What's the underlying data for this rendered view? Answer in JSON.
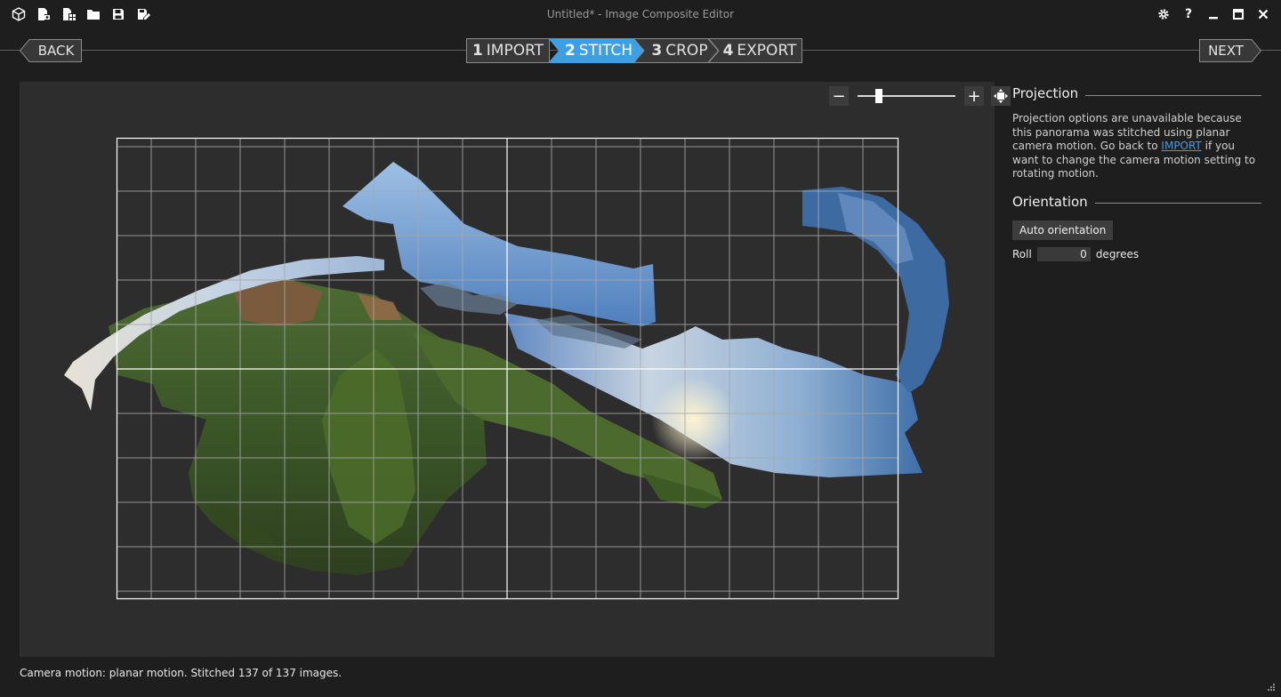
{
  "window": {
    "title": "Untitled* - Image Composite Editor",
    "toolbar_icons": [
      "new-panorama-icon",
      "new-from-video-icon",
      "new-structured-icon",
      "open-icon",
      "save-icon",
      "save-as-icon"
    ],
    "controls": [
      "settings-icon",
      "help-icon",
      "minimize-icon",
      "maximize-icon",
      "close-icon"
    ],
    "help_label": "?"
  },
  "nav": {
    "back_label": "BACK",
    "next_label": "NEXT",
    "steps": [
      {
        "num": "1",
        "label": "IMPORT"
      },
      {
        "num": "2",
        "label": "STITCH"
      },
      {
        "num": "3",
        "label": "CROP"
      },
      {
        "num": "4",
        "label": "EXPORT"
      }
    ],
    "active_step": 2,
    "accent_color": "#3d9fe6"
  },
  "zoom": {
    "minus": "−",
    "plus": "+",
    "level_fraction": 0.2,
    "fit_icon": "fit-to-window-icon"
  },
  "panel": {
    "projection_title": "Projection",
    "projection_desc_1": "Projection options are unavailable because this panorama was stitched using planar camera motion. Go back to ",
    "projection_link": "IMPORT",
    "projection_desc_2": " if you want to change the camera motion setting to rotating motion.",
    "orientation_title": "Orientation",
    "auto_orientation_label": "Auto orientation",
    "roll_label": "Roll",
    "roll_value": "0",
    "roll_unit": "degrees"
  },
  "status": "Camera motion: planar motion. Stitched 137 of 137 images."
}
